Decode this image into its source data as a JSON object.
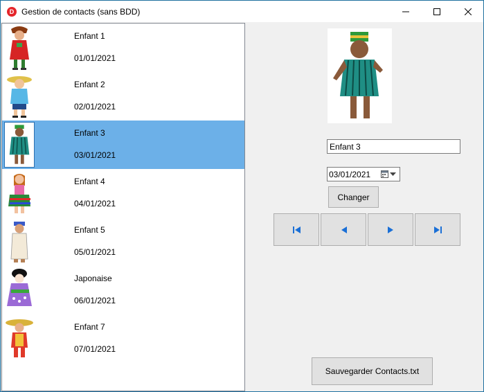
{
  "window": {
    "title": "Gestion de contacts (sans BDD)",
    "icon_letter": "D",
    "icon": "app-logo-icon"
  },
  "contacts": [
    {
      "name": "Enfant 1",
      "date": "01/01/2021",
      "selected": false
    },
    {
      "name": "Enfant 2",
      "date": "02/01/2021",
      "selected": false
    },
    {
      "name": "Enfant 3",
      "date": "03/01/2021",
      "selected": true
    },
    {
      "name": "Enfant 4",
      "date": "04/01/2021",
      "selected": false
    },
    {
      "name": "Enfant 5",
      "date": "05/01/2021",
      "selected": false
    },
    {
      "name": "Japonaise",
      "date": "06/01/2021",
      "selected": false
    },
    {
      "name": "Enfant 7",
      "date": "07/01/2021",
      "selected": false
    }
  ],
  "detail": {
    "name_value": "Enfant 3",
    "date_value": "03/01/2021",
    "change_label": "Changer",
    "save_label": "Sauvegarder Contacts.txt"
  },
  "colors": {
    "selection": "#6cb0e8",
    "button_face": "#e1e1e1",
    "nav_arrow": "#1a6fd6",
    "app_icon": "#e5252a"
  }
}
